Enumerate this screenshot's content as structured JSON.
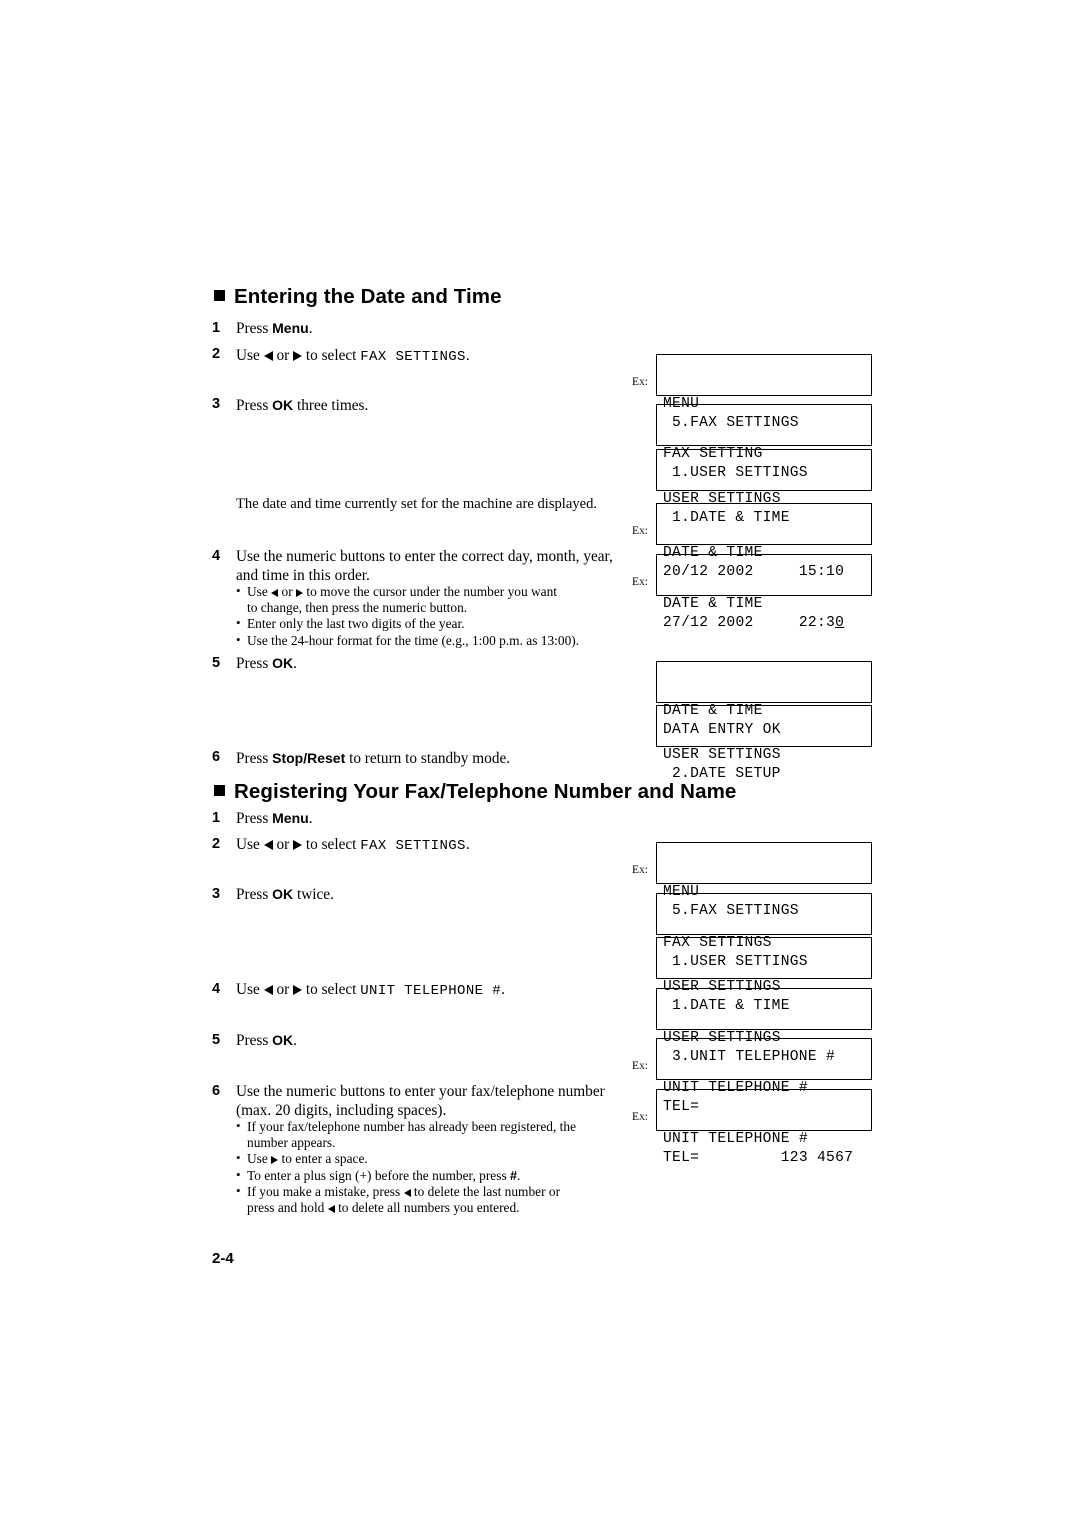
{
  "page": {
    "folio": "2-4"
  },
  "sections": [
    {
      "heading": "Entering the Date and Time",
      "steps": [
        {
          "num": "1",
          "text_before": "Press ",
          "bold": "Menu",
          "text_after": "."
        },
        {
          "num": "2",
          "text_before": "Use ",
          "arrow1": "left",
          "mid": " or ",
          "arrow2": "right",
          "text_after": " to select ",
          "mono": "FAX SETTINGS",
          "tail": "."
        },
        {
          "num": "3",
          "text_before": "Press ",
          "bold": "OK",
          "text_after": " three times."
        },
        {
          "num": "4",
          "text": "Use the numeric buttons to enter the correct day, month, year, and time in this order."
        },
        {
          "num": "5",
          "text_before": "Press ",
          "bold": "OK",
          "text_after": "."
        },
        {
          "num": "6",
          "text_before": "Press ",
          "bold": "Stop/Reset",
          "text_after": " to return to standby mode."
        }
      ],
      "note": "The date and time currently set for the machine are displayed.",
      "bullets": [
        "Use ◀ or ▶ to move the cursor under the number you want to change, then press the numeric button.",
        "Enter only the last two digits of the year.",
        "Use the 24-hour format for the time (e.g., 1:00 p.m. as 13:00)."
      ],
      "lcds": [
        {
          "line1": "MENU",
          "line2": "5.FAX SETTINGS",
          "ex": "Ex:",
          "indent2": 1
        },
        {
          "line1": "FAX SETTING",
          "line2": "1.USER SETTINGS",
          "ex": "",
          "indent2": 1
        },
        {
          "line1": "USER SETTINGS",
          "line2": "1.DATE & TIME",
          "ex": "",
          "indent2": 1
        },
        {
          "line1": "DATE & TIME",
          "line2": "20/12 2002     15:10",
          "ex": "Ex:",
          "indent2": 0
        },
        {
          "line1": "DATE & TIME",
          "line2": "27/12 2002     22:30",
          "ex": "Ex:",
          "indent2": 0,
          "underline_last": true
        },
        {
          "line1": "DATE & TIME",
          "line2": "DATA ENTRY OK",
          "ex": "",
          "indent2": 0
        },
        {
          "line1": "USER SETTINGS",
          "line2": "2.DATE SETUP",
          "ex": "",
          "indent2": 1
        }
      ]
    },
    {
      "heading": "Registering Your Fax/Telephone Number and Name",
      "steps": [
        {
          "num": "1",
          "text_before": "Press ",
          "bold": "Menu",
          "text_after": "."
        },
        {
          "num": "2",
          "text_before": "Use ",
          "arrow1": "left",
          "mid": " or ",
          "arrow2": "right",
          "text_after": " to select ",
          "mono": "FAX SETTINGS",
          "tail": "."
        },
        {
          "num": "3",
          "text_before": "Press ",
          "bold": "OK",
          "text_after": " twice."
        },
        {
          "num": "4",
          "text_before": "Use ",
          "arrow1": "left",
          "mid": " or ",
          "arrow2": "right",
          "text_after": " to select ",
          "mono": "UNIT TELEPHONE #",
          "tail": "."
        },
        {
          "num": "5",
          "text_before": "Press ",
          "bold": "OK",
          "text_after": "."
        },
        {
          "num": "6",
          "text": "Use the numeric buttons to enter your fax/telephone number (max. 20 digits, including spaces)."
        }
      ],
      "bullets": [
        "If your fax/telephone number has already been registered, the number appears.",
        "Use ▶ to enter a space.",
        "To enter a plus sign (+) before the number, press #.",
        "If you make a mistake, press ◀ to delete the last number or press and hold ◀ to delete all numbers you entered."
      ],
      "lcds": [
        {
          "line1": "MENU",
          "line2": "5.FAX SETTINGS",
          "ex": "Ex:",
          "indent2": 1
        },
        {
          "line1": "FAX SETTINGS",
          "line2": "1.USER SETTINGS",
          "ex": "",
          "indent2": 1
        },
        {
          "line1": "USER SETTINGS",
          "line2": "1.DATE & TIME",
          "ex": "",
          "indent2": 1
        },
        {
          "line1": "USER SETTINGS",
          "line2": "3.UNIT TELEPHONE #",
          "ex": "",
          "indent2": 1
        },
        {
          "line1": "UNIT TELEPHONE #",
          "line2": "TEL=",
          "ex": "Ex:",
          "indent2": 0
        },
        {
          "line1": "UNIT TELEPHONE #",
          "line2": "TEL=         123 4567",
          "ex": "Ex:",
          "indent2": 0
        }
      ]
    }
  ]
}
